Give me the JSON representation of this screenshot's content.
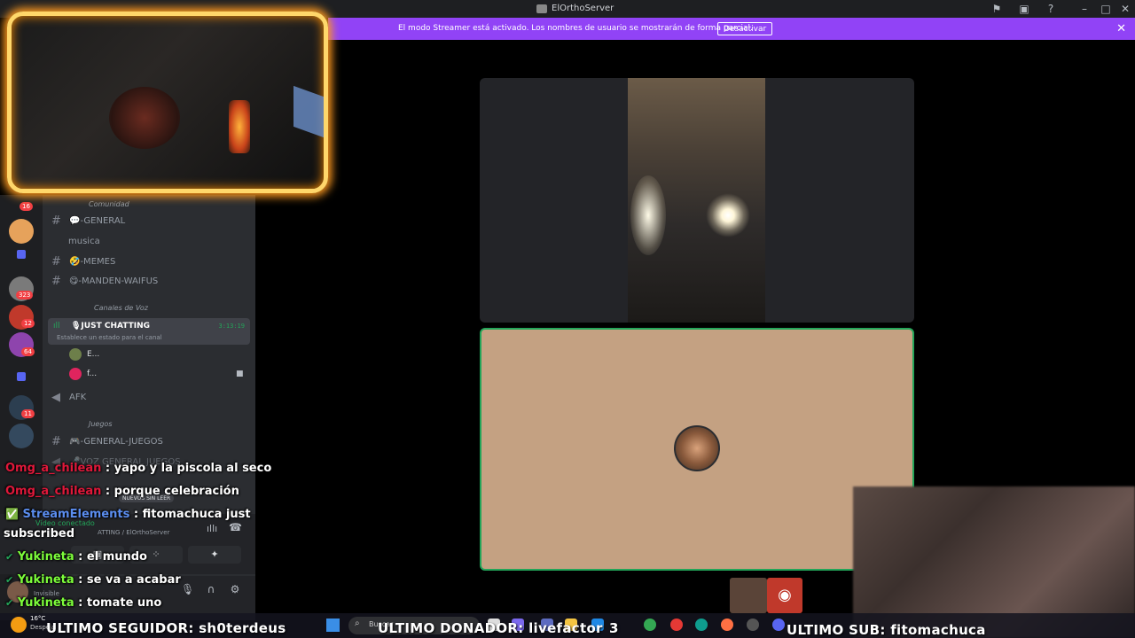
{
  "window": {
    "title": "ElOrthoServer",
    "controls": [
      "inbox-icon",
      "help-icon",
      "minimize-icon",
      "maximize-icon",
      "close-icon"
    ]
  },
  "banner": {
    "message": "El modo Streamer está activado. Los nombres de usuario se mostrarán de forma parcial.",
    "button": "Desactivar",
    "close": "✕"
  },
  "sidebar": {
    "categories": {
      "comunidad": "Comunidad",
      "voz": "Canales de Voz",
      "juegos": "Juegos"
    },
    "text_channels": [
      {
        "name": "💬-GENERAL"
      },
      {
        "name": "musica"
      },
      {
        "name": "🤣-MEMES"
      },
      {
        "name": "😋-MANDEN-WAIFUS"
      }
    ],
    "voice_active": {
      "name": "🎙JUST CHATTING",
      "status": "Establece un estado para el canal",
      "timer": "3:13:19",
      "users": [
        "E...",
        "f..."
      ]
    },
    "afk": "AFK",
    "game_channels": [
      {
        "name": "🎮-GENERAL-JUEGOS"
      },
      {
        "name": "🎤VOZ GENERAL JUEGOS"
      }
    ],
    "unread": "NUEVOS SIN LEER",
    "voice_panel": {
      "status": "Vídeo conectado",
      "sub": "ATTING / ElOrthoServer"
    },
    "user": {
      "name": "Invisible"
    }
  },
  "server_badges": [
    "16",
    "323",
    "12",
    "64",
    "11"
  ],
  "chat": [
    {
      "user": "Omg_a_chilean",
      "text": " : yapo y la piscola al seco",
      "color": "#e0183a"
    },
    {
      "user": "Omg_a_chilean",
      "text": " : porque celebración",
      "color": "#e0183a"
    },
    {
      "user": "StreamElements",
      "text": " : fitomachuca just",
      "color": "#5b8def"
    },
    {
      "user": "",
      "text": "subscribed",
      "color": "#ffffff"
    },
    {
      "user": "Yukineta",
      "text": " : el mundo",
      "color": "#7cfc3a"
    },
    {
      "user": "Yukineta",
      "text": " : se va a acabar",
      "color": "#7cfc3a"
    },
    {
      "user": "Yukineta",
      "text": " : tomate uno",
      "color": "#7cfc3a"
    }
  ],
  "ticker": {
    "follower": "ULTIMO SEGUIDOR: sh0terdeus",
    "donor": "ULTIMO DONADOR: livefactor",
    "donor_amount": "3",
    "sub": "ULTIMO SUB: fitomachuca"
  },
  "taskbar": {
    "weather": "16°C",
    "weather_sub": "Despeja",
    "search": "Buscar"
  },
  "colors": {
    "banner": "#9143f6",
    "speaking_border": "#23a559",
    "tile_bg": "#c4a182",
    "webcam_glow": "#ff9a1f"
  }
}
